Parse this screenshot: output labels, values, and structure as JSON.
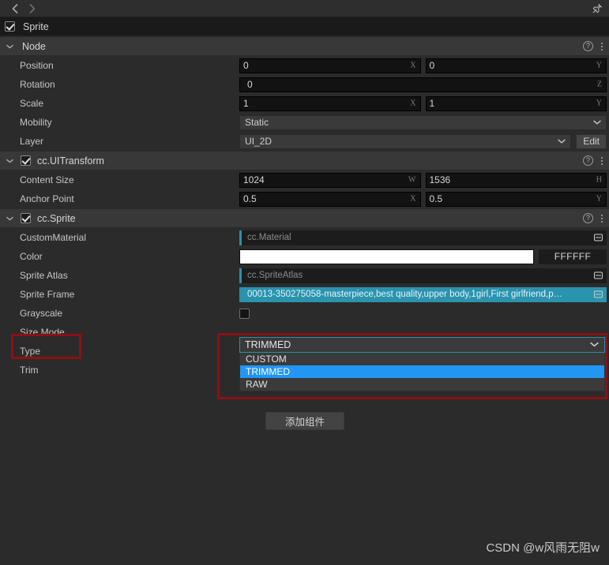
{
  "navbar": {
    "back_icon": "chevron-left-icon",
    "forward_icon": "chevron-right-icon",
    "pin_icon": "pin-icon"
  },
  "node": {
    "name": "Sprite",
    "enabled": true
  },
  "sections": [
    {
      "title": "Node",
      "has_checkbox": false,
      "properties": [
        {
          "label": "Position",
          "type": "vec2",
          "fields": [
            {
              "value": "0",
              "axis": "X"
            },
            {
              "value": "0",
              "axis": "Y"
            }
          ]
        },
        {
          "label": "Rotation",
          "type": "single",
          "fields": [
            {
              "value": "0",
              "axis": "Z"
            }
          ]
        },
        {
          "label": "Scale",
          "type": "vec2",
          "fields": [
            {
              "value": "1",
              "axis": "X"
            },
            {
              "value": "1",
              "axis": "Y"
            }
          ]
        },
        {
          "label": "Mobility",
          "type": "select",
          "value": "Static"
        },
        {
          "label": "Layer",
          "type": "select_edit",
          "value": "UI_2D",
          "button": "Edit"
        }
      ]
    },
    {
      "title": "cc.UITransform",
      "has_checkbox": true,
      "enabled": true,
      "properties": [
        {
          "label": "Content Size",
          "type": "vec2",
          "fields": [
            {
              "value": "1024",
              "axis": "W"
            },
            {
              "value": "1536",
              "axis": "H"
            }
          ]
        },
        {
          "label": "Anchor Point",
          "type": "vec2",
          "fields": [
            {
              "value": "0.5",
              "axis": "X"
            },
            {
              "value": "0.5",
              "axis": "Y"
            }
          ]
        }
      ]
    },
    {
      "title": "cc.Sprite",
      "has_checkbox": true,
      "enabled": true,
      "properties": [
        {
          "label": "CustomMaterial",
          "type": "asset",
          "value": "cc.Material",
          "filled": false
        },
        {
          "label": "Color",
          "type": "color",
          "swatch": "#FFFFFF",
          "hex": "FFFFFF"
        },
        {
          "label": "Sprite Atlas",
          "type": "asset",
          "value": "cc.SpriteAtlas",
          "filled": false
        },
        {
          "label": "Sprite Frame",
          "type": "asset",
          "value": "00013-350275058-masterpiece,best quality,upper body,1girl,First girlfriend,p…",
          "filled": true
        },
        {
          "label": "Grayscale",
          "type": "checkbox",
          "checked": false
        },
        {
          "label": "Size Mode",
          "type": "dropdown_open",
          "value": "TRIMMED"
        },
        {
          "label": "Type",
          "type": "blank"
        },
        {
          "label": "Trim",
          "type": "blank"
        }
      ]
    }
  ],
  "size_mode_dropdown": {
    "selected": "TRIMMED",
    "options": [
      {
        "label": "CUSTOM",
        "highlighted": false
      },
      {
        "label": "TRIMMED",
        "highlighted": true
      },
      {
        "label": "RAW",
        "highlighted": false
      }
    ]
  },
  "add_component_button": {
    "label": "添加组件"
  },
  "watermark": {
    "text": "CSDN @w风雨无阻w"
  },
  "icons": {
    "help": "?",
    "menu": "kebab-menu-icon",
    "chevron_down": "⌄",
    "chevron_left": "❮",
    "chevron_right": "❯"
  },
  "colors": {
    "accent_teal": "#2a93ae",
    "highlight_blue": "#2196f3",
    "annotation_red": "#8b1116",
    "panel_bg": "#2b2b2b",
    "header_bg": "#383838"
  }
}
